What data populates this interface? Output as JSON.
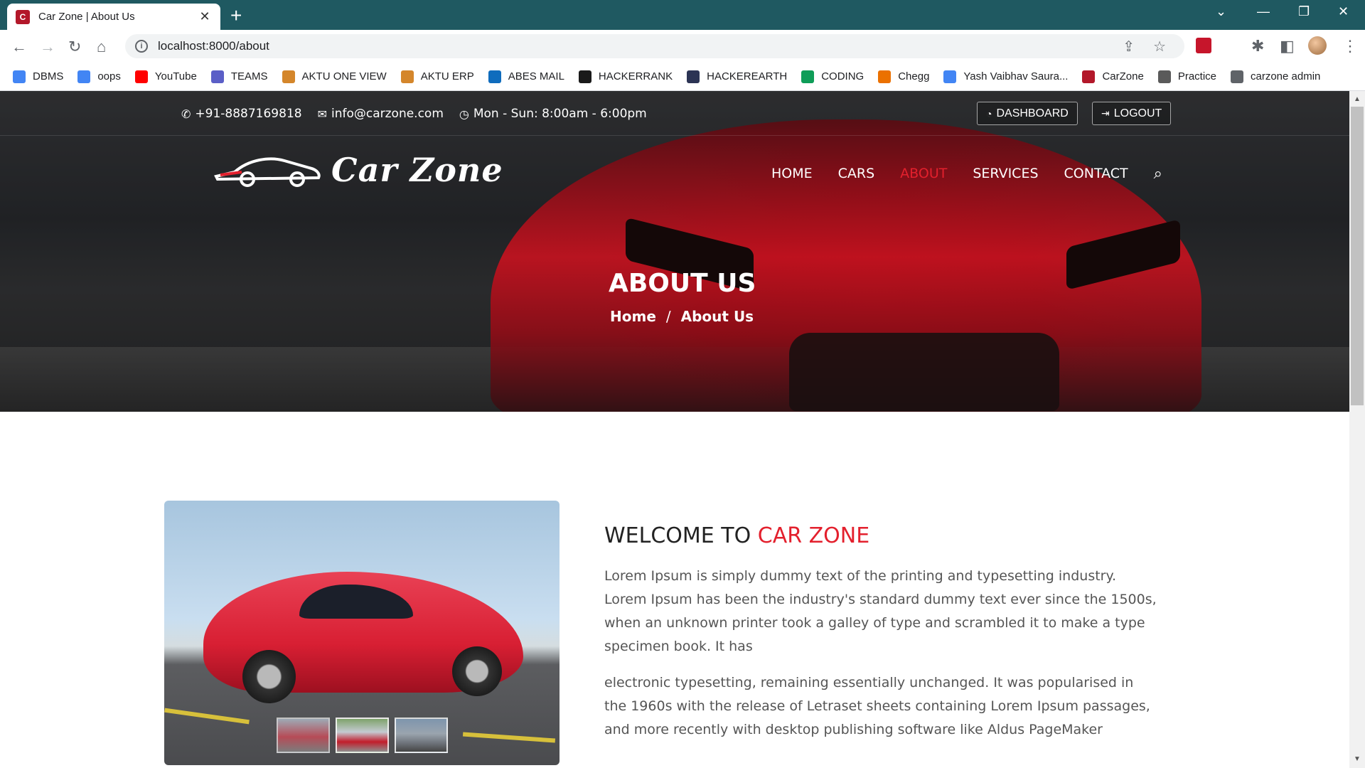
{
  "browser": {
    "tab_title": "Car Zone | About Us",
    "url": "localhost:8000/about",
    "bookmarks": [
      {
        "label": "DBMS",
        "color": "#4285f4"
      },
      {
        "label": "oops",
        "color": "#4285f4"
      },
      {
        "label": "YouTube",
        "color": "#ff0000"
      },
      {
        "label": "TEAMS",
        "color": "#5b5fc7"
      },
      {
        "label": "AKTU ONE VIEW",
        "color": "#d4862b"
      },
      {
        "label": "AKTU ERP",
        "color": "#d4862b"
      },
      {
        "label": "ABES MAIL",
        "color": "#0f6cbd"
      },
      {
        "label": "HACKERRANK",
        "color": "#1a1a1a"
      },
      {
        "label": "HACKEREARTH",
        "color": "#2c3454"
      },
      {
        "label": "CODING",
        "color": "#0f9d58"
      },
      {
        "label": "Chegg",
        "color": "#eb7100"
      },
      {
        "label": "Yash Vaibhav Saura...",
        "color": "#4285f4"
      },
      {
        "label": "CarZone",
        "color": "#b3182a"
      },
      {
        "label": "Practice",
        "color": "#5a5a5a"
      },
      {
        "label": "carzone admin",
        "color": "#5f6368"
      }
    ]
  },
  "header": {
    "phone": "+91-8887169818",
    "email": "info@carzone.com",
    "hours": "Mon - Sun: 8:00am - 6:00pm",
    "dashboard_label": "DASHBOARD",
    "logout_label": "LOGOUT",
    "logo_text": "Car Zone",
    "nav": [
      {
        "label": "HOME",
        "active": false
      },
      {
        "label": "CARS",
        "active": false
      },
      {
        "label": "ABOUT",
        "active": true
      },
      {
        "label": "SERVICES",
        "active": false
      },
      {
        "label": "CONTACT",
        "active": false
      }
    ]
  },
  "hero": {
    "title": "ABOUT US",
    "breadcrumb_home": "Home",
    "breadcrumb_sep": "/",
    "breadcrumb_current": "About Us"
  },
  "about": {
    "welcome_prefix": "WELCOME TO ",
    "welcome_accent": "CAR ZONE",
    "paragraph1": "Lorem Ipsum is simply dummy text of the printing and typesetting industry. Lorem Ipsum has been the industry's standard dummy text ever since the 1500s, when an unknown printer took a galley of type and scrambled it to make a type specimen book. It has",
    "paragraph2": "electronic typesetting, remaining essentially unchanged. It was popularised in the 1960s with the release of Letraset sheets containing Lorem Ipsum passages, and more recently with desktop publishing software like Aldus PageMaker"
  },
  "colors": {
    "accent": "#e3202d",
    "titlebar": "#1f5961"
  }
}
